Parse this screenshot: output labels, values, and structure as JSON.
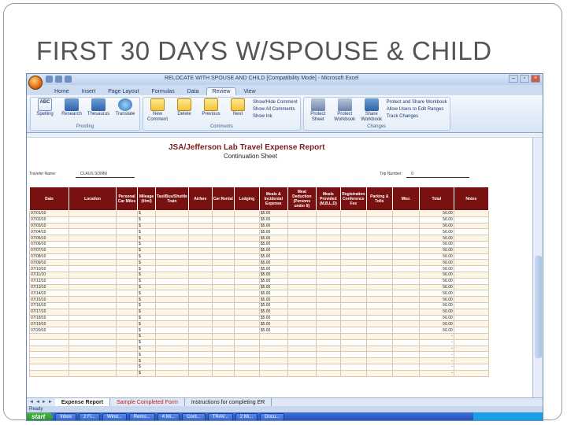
{
  "slide": {
    "title": "FIRST 30 DAYS W/SPOUSE & CHILD"
  },
  "window": {
    "title": "RELOCATE WITH SPOUSE AND CHILD [Compatibility Mode] - Microsoft Excel"
  },
  "ribbon": {
    "tabs": [
      "Home",
      "Insert",
      "Page Layout",
      "Formulas",
      "Data",
      "Review",
      "View"
    ],
    "active_tab": "Review",
    "proofing": {
      "buttons": [
        "Spelling",
        "Research",
        "Thesaurus",
        "Translate"
      ],
      "label": "Proofing"
    },
    "comments": {
      "buttons": [
        "New Comment",
        "Delete",
        "Previous",
        "Next"
      ],
      "small": [
        "Show/Hide Comment",
        "Show All Comments",
        "Show Ink"
      ],
      "label": "Comments"
    },
    "changes": {
      "buttons": [
        "Protect Sheet",
        "Protect Workbook",
        "Share Workbook"
      ],
      "small": [
        "Protect and Share Workbook",
        "Allow Users to Edit Ranges",
        "Track Changes"
      ],
      "label": "Changes"
    }
  },
  "report": {
    "title": "JSA/Jefferson Lab Travel Expense Report",
    "subtitle": "Continuation Sheet",
    "traveler_label": "Traveler Name:",
    "traveler_value": "CLAUS SONNI",
    "trip_label": "Trip Number:",
    "trip_value": "0"
  },
  "table": {
    "headers": [
      "Date",
      "Location",
      "Personal Car Miles",
      "Mileage (¢/mi)",
      "Taxi/Bus/Shuttle Train",
      "Airfare",
      "Car Rental",
      "Lodging",
      "Meals & Incidental Expense",
      "Meal Deduction (Persons under 8)",
      "Meals Provided (M,B,L,D)",
      "Registration Conference Fee",
      "Parking & Tolls",
      "Misc",
      "Total",
      "Notes"
    ],
    "rows": [
      {
        "date": "07/01/10",
        "mileage": "$",
        "meals": "$5.00",
        "total": "56.00"
      },
      {
        "date": "07/02/10",
        "mileage": "$",
        "meals": "$5.00",
        "total": "56.00"
      },
      {
        "date": "07/03/10",
        "mileage": "$",
        "meals": "$5.00",
        "total": "56.00"
      },
      {
        "date": "07/04/10",
        "mileage": "$",
        "meals": "$5.00",
        "total": "56.00"
      },
      {
        "date": "07/05/10",
        "mileage": "$",
        "meals": "$5.00",
        "total": "56.00"
      },
      {
        "date": "07/06/10",
        "mileage": "$",
        "meals": "$5.00",
        "total": "56.00"
      },
      {
        "date": "07/07/10",
        "mileage": "$",
        "meals": "$5.00",
        "total": "56.00"
      },
      {
        "date": "07/08/10",
        "mileage": "$",
        "meals": "$5.00",
        "total": "56.00"
      },
      {
        "date": "07/09/10",
        "mileage": "$",
        "meals": "$5.00",
        "total": "56.00"
      },
      {
        "date": "07/10/10",
        "mileage": "$",
        "meals": "$5.00",
        "total": "56.00"
      },
      {
        "date": "07/11/10",
        "mileage": "$",
        "meals": "$5.00",
        "total": "56.00"
      },
      {
        "date": "07/12/10",
        "mileage": "$",
        "meals": "$5.00",
        "total": "56.00"
      },
      {
        "date": "07/13/10",
        "mileage": "$",
        "meals": "$5.00",
        "total": "56.00"
      },
      {
        "date": "07/14/10",
        "mileage": "$",
        "meals": "$5.00",
        "total": "56.00"
      },
      {
        "date": "07/15/10",
        "mileage": "$",
        "meals": "$5.00",
        "total": "56.00"
      },
      {
        "date": "07/16/10",
        "mileage": "$",
        "meals": "$5.00",
        "total": "56.00"
      },
      {
        "date": "07/17/10",
        "mileage": "$",
        "meals": "$5.00",
        "total": "56.00"
      },
      {
        "date": "07/18/10",
        "mileage": "$",
        "meals": "$5.00",
        "total": "56.00"
      },
      {
        "date": "07/19/10",
        "mileage": "$",
        "meals": "$5.00",
        "total": "56.00"
      },
      {
        "date": "07/20/10",
        "mileage": "$",
        "meals": "$5.00",
        "total": "56.00"
      },
      {
        "date": "",
        "mileage": "$",
        "meals": "",
        "total": "-"
      },
      {
        "date": "",
        "mileage": "$",
        "meals": "",
        "total": "-"
      },
      {
        "date": "",
        "mileage": "$",
        "meals": "",
        "total": "-"
      },
      {
        "date": "",
        "mileage": "$",
        "meals": "",
        "total": "-"
      },
      {
        "date": "",
        "mileage": "$",
        "meals": "",
        "total": "-"
      },
      {
        "date": "",
        "mileage": "$",
        "meals": "",
        "total": "-"
      },
      {
        "date": "",
        "mileage": "$",
        "meals": "",
        "total": "-"
      }
    ]
  },
  "sheet_tabs": [
    "Expense Report",
    "Sample Completed Form",
    "Instructions for completing ER"
  ],
  "status": "Ready",
  "taskbar": {
    "start": "start",
    "items": [
      "Inbox",
      "2 Fi...",
      "Wind...",
      "Remo...",
      "4 Mi...",
      "Cont...",
      "TRAV...",
      "2 Mi...",
      "Docu..."
    ]
  }
}
